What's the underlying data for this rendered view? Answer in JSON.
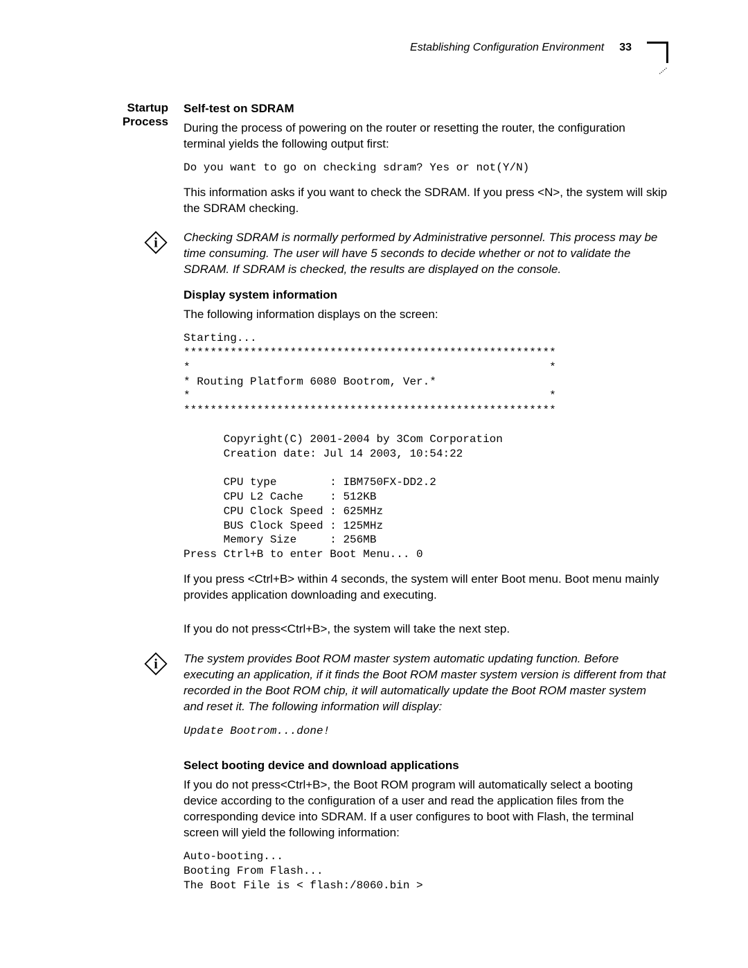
{
  "header": {
    "title": "Establishing Configuration Environment",
    "page": "33"
  },
  "left_label": "Startup Process",
  "s1": {
    "title": "Self-test on SDRAM",
    "p1": "During the process of powering on the router or resetting the router, the configuration terminal yields the following output first:",
    "code1": "Do you want to go on checking sdram? Yes or not(Y/N)",
    "p2": "This information asks if you want to check the SDRAM. If you press <N>, the system will skip the SDRAM checking.",
    "note": "Checking SDRAM is normally performed by Administrative personnel. This process may be time consuming. The user will have 5 seconds to decide whether or not to validate the SDRAM. If SDRAM is checked, the results are displayed on the console."
  },
  "s2": {
    "title": "Display system information",
    "p1": "The following information displays on the screen:",
    "code": "Starting...\n********************************************************\n*                                                      *\n* Routing Platform 6080 Bootrom, Ver.*\n*                                                      *\n********************************************************\n\n      Copyright(C) 2001-2004 by 3Com Corporation\n      Creation date: Jul 14 2003, 10:54:22\n\n      CPU type        : IBM750FX-DD2.2\n      CPU L2 Cache    : 512KB\n      CPU Clock Speed : 625MHz\n      BUS Clock Speed : 125MHz\n      Memory Size     : 256MB\nPress Ctrl+B to enter Boot Menu... 0",
    "p2": "If you press <Ctrl+B> within 4 seconds, the system will enter Boot menu. Boot menu mainly provides application downloading and executing.",
    "p3": "If you do not press<Ctrl+B>, the system will take the next step.",
    "note": "The system provides Boot ROM master system automatic updating function. Before executing an application, if it finds the Boot ROM master system version is different from that recorded in the Boot ROM chip, it will automatically update the Boot ROM master system and reset it. The following information will display:",
    "note_code": "Update Bootrom...done!"
  },
  "s3": {
    "title": "Select booting device and download applications",
    "p1": "If you do not press<Ctrl+B>, the Boot ROM program will automatically select a booting device according to the configuration of a user and read the application files from the corresponding device into SDRAM. If a user configures to boot with Flash, the terminal screen will yield the following information:",
    "code": "Auto-booting...\nBooting From Flash...\nThe Boot File is < flash:/8060.bin >"
  }
}
